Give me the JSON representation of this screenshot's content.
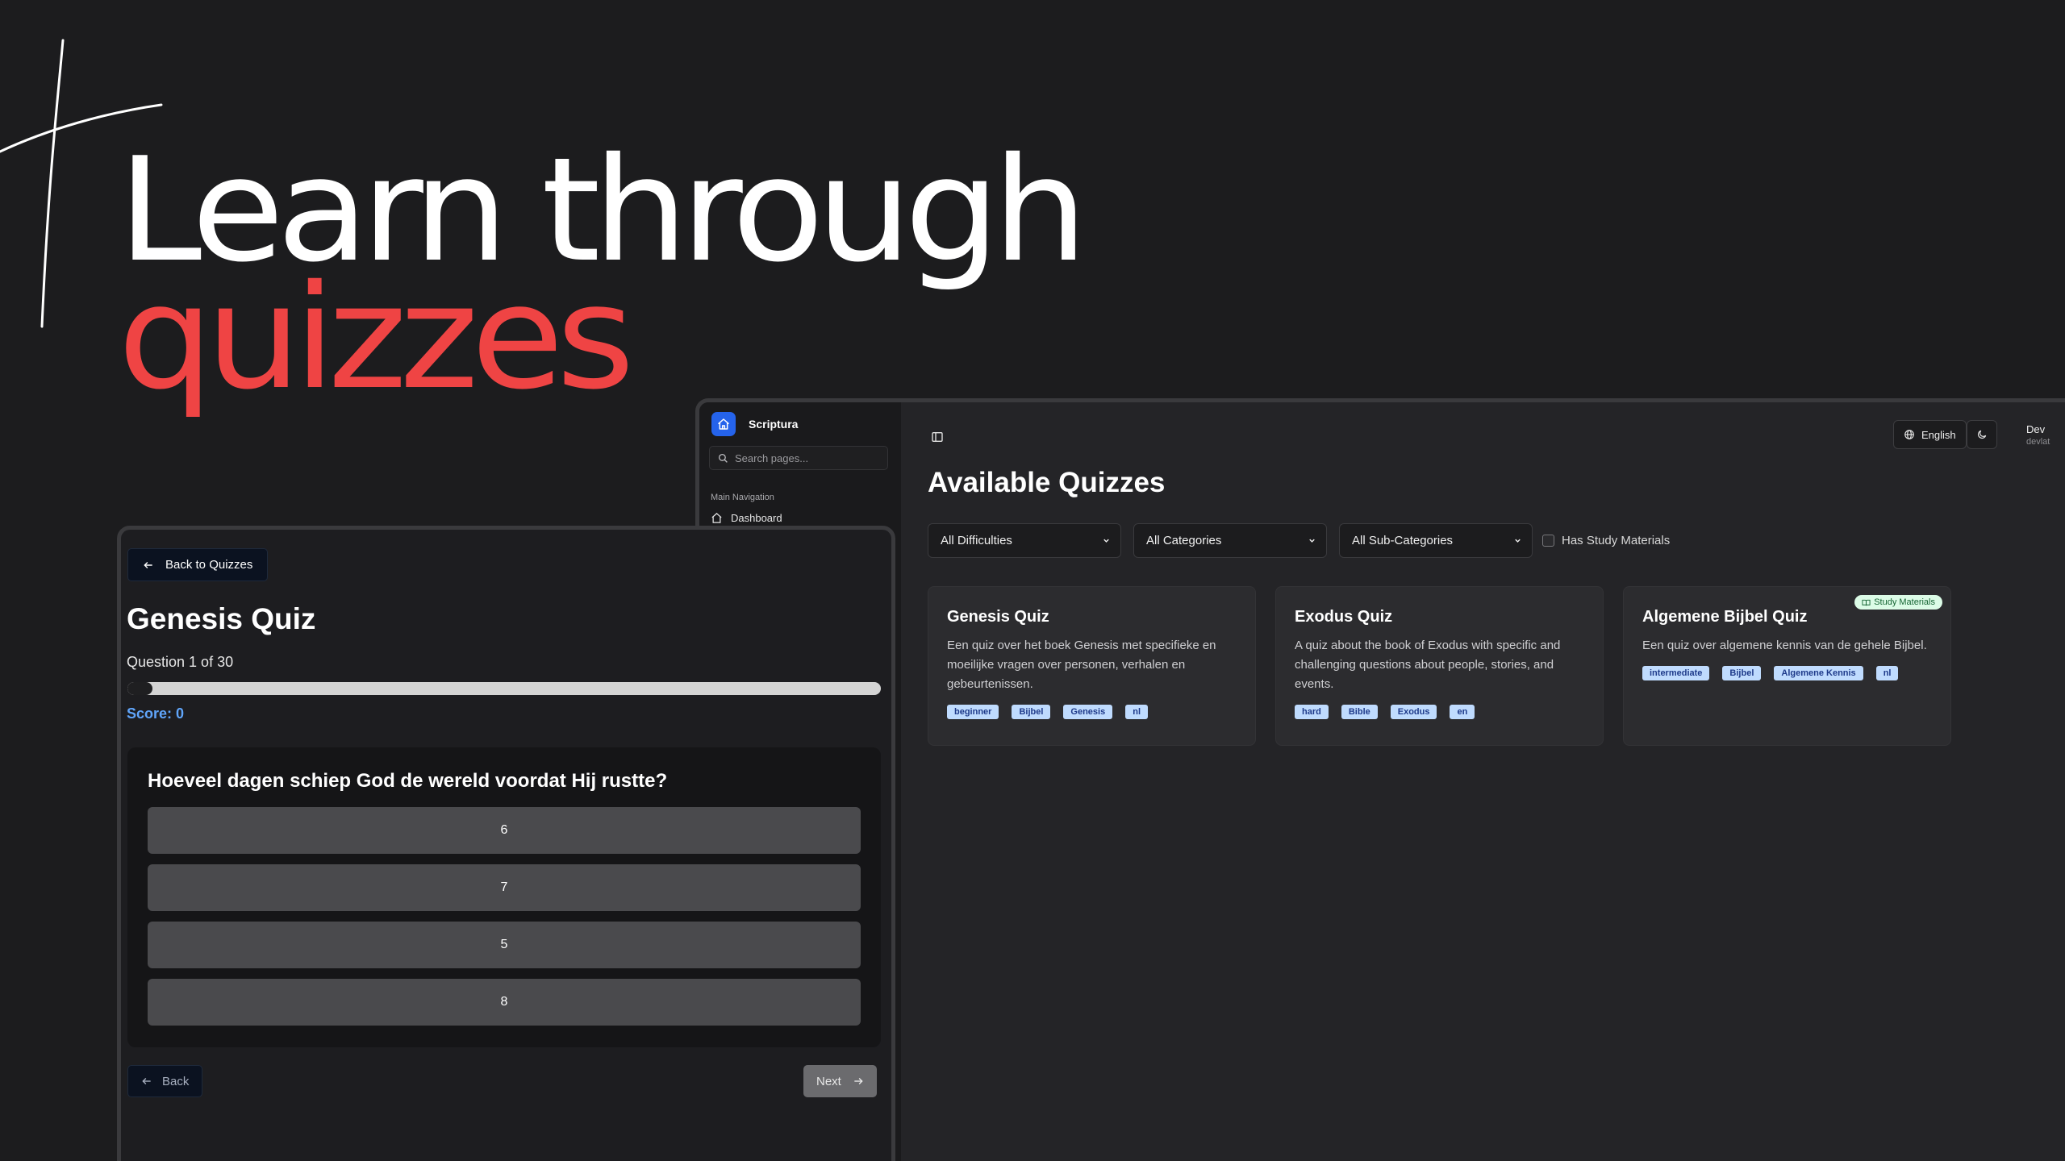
{
  "hero": {
    "line1": "Learn through",
    "line2": "quizzes",
    "accent_color": "#ef4444"
  },
  "dashboard": {
    "sidebar": {
      "app_name": "Scriptura",
      "logo_icon": "home-icon",
      "search_placeholder": "Search pages...",
      "section_label": "Main Navigation",
      "items": [
        {
          "label": "Dashboard",
          "icon": "home-icon"
        }
      ]
    },
    "header": {
      "panel_toggle_icon": "sidebar-toggle-icon",
      "language_label": "English",
      "language_icon": "globe-icon",
      "theme_icon": "moon-icon",
      "user_name": "Dev",
      "user_sub": "devlat"
    },
    "page_title": "Available Quizzes",
    "filters": {
      "difficulty": "All Difficulties",
      "category": "All Categories",
      "sub_category": "All Sub-Categories",
      "study_materials_label": "Has Study Materials"
    },
    "quizzes": [
      {
        "title": "Genesis Quiz",
        "description": "Een quiz over het boek Genesis met specifieke en moeilijke vragen over personen, verhalen en gebeurtenissen.",
        "tags": [
          "beginner",
          "Bijbel",
          "Genesis",
          "nl"
        ],
        "badge": ""
      },
      {
        "title": "Exodus Quiz",
        "description": "A quiz about the book of Exodus with specific and challenging questions about people, stories, and events.",
        "tags": [
          "hard",
          "Bible",
          "Exodus",
          "en"
        ],
        "badge": ""
      },
      {
        "title": "Algemene Bijbel Quiz",
        "description": "Een quiz over algemene kennis van de gehele Bijbel.",
        "tags": [
          "intermediate",
          "Bijbel",
          "Algemene Kennis",
          "nl"
        ],
        "badge": "Study Materials"
      }
    ],
    "tag_color": "#bfdbfe"
  },
  "quiz": {
    "back_to_quizzes_label": "Back to Quizzes",
    "title": "Genesis Quiz",
    "question_counter": "Question 1 of 30",
    "progress_fraction": 0.0333,
    "score_label": "Score: 0",
    "question": "Hoeveel dagen schiep God de wereld voordat Hij rustte?",
    "options": [
      "6",
      "7",
      "5",
      "8"
    ],
    "back_label": "Back",
    "next_label": "Next",
    "score_color": "#60a5fa"
  }
}
